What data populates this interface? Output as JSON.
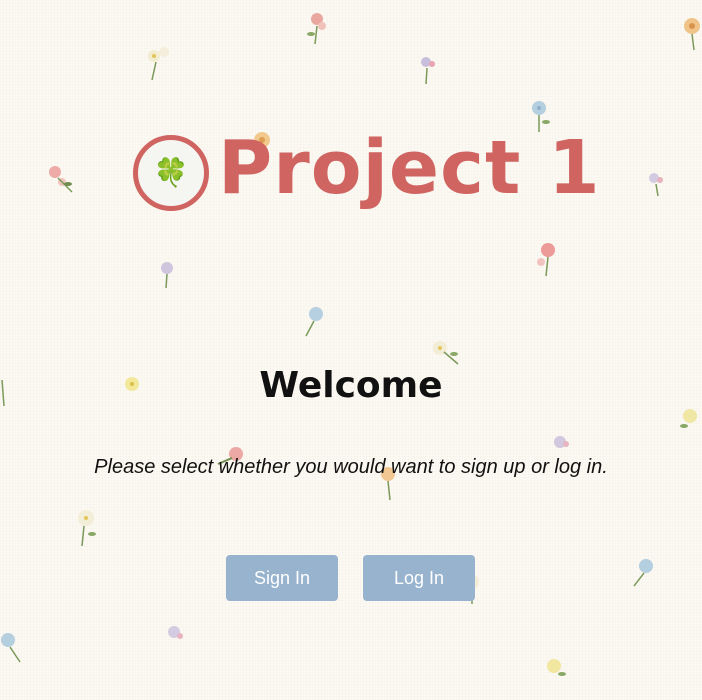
{
  "header": {
    "app_title": "Project 1",
    "logo_icon": "four-leaf-clover-icon",
    "logo_glyph": "🍀"
  },
  "main": {
    "heading": "Welcome",
    "instructions": "Please select whether you would want to sign up or log in."
  },
  "actions": {
    "sign_in_label": "Sign In",
    "log_in_label": "Log In"
  },
  "colors": {
    "background": "#fcf8f2",
    "accent": "#cf6461",
    "button": "#97b3cd",
    "button_text": "#ffffff",
    "text": "#111111"
  }
}
